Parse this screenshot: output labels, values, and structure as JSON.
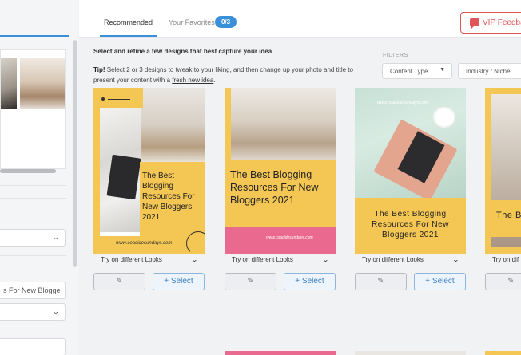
{
  "sidebar": {
    "title_select_value": "s For New Blogge"
  },
  "header": {
    "tabs": [
      {
        "label": "Recommended",
        "active": true
      },
      {
        "label": "Your Favorites",
        "badge": "0/3",
        "active": false
      }
    ],
    "vip_button_label": "VIP Feedba"
  },
  "main": {
    "intro": "Select and refine a few designs that best capture your idea",
    "tip": {
      "prefix": "Tip!",
      "text": " Select 2 or 3 designs to tweak to your liking, and then change up your photo and title to present your content with a ",
      "link": "fresh new idea",
      "suffix": "."
    },
    "filters": {
      "label": "FILTERS",
      "content_type": "Content Type",
      "industry": "Industry / Niche"
    }
  },
  "cards": [
    {
      "design_title": "The Best Blogging Resources For New Bloggers 2021",
      "site": "www.coacidesundays.com",
      "looks_label": "Try on different Looks",
      "select_label": "+ Select"
    },
    {
      "design_title": "The Best Blogging Resources For New Bloggers 2021",
      "site": "www.coacidesundays.com",
      "looks_label": "Try on different Looks",
      "select_label": "+ Select"
    },
    {
      "design_title": "The Best Blogging Resources For New Bloggers 2021",
      "site": "www.coacidesundays.com",
      "looks_label": "Try on different Looks",
      "select_label": "+ Select"
    },
    {
      "design_title": "The Best Resou Blo",
      "looks_label": "Try on dif"
    }
  ],
  "colors": {
    "accent": "#3a8fd9",
    "vip": "#e05555",
    "yellow": "#f4c653",
    "pink": "#ea6a8f"
  },
  "icons": [
    "pencil-icon",
    "chevron-down-icon",
    "feedback-icon"
  ]
}
